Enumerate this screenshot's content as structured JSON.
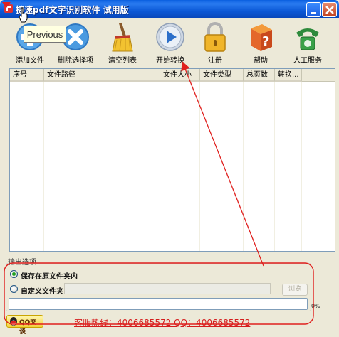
{
  "window": {
    "title": "捷速pdf文字识别软件  试用版",
    "accent": "#0b58d6"
  },
  "tooltip": {
    "text": "Previous"
  },
  "toolbar": {
    "add_file": "添加文件",
    "delete_selected": "删除选择项",
    "clear_list": "清空列表",
    "start_convert": "开始转换",
    "register": "注册",
    "help": "帮助",
    "support": "人工服务"
  },
  "icons": {
    "add_file": "plus-icon",
    "delete_selected": "x-icon",
    "clear_list": "broom-icon",
    "start_convert": "play-icon",
    "register": "padlock-icon",
    "help": "help-book-icon",
    "support": "telephone-icon"
  },
  "table": {
    "columns": [
      "序号",
      "文件路径",
      "文件大小",
      "文件类型",
      "总页数",
      "转换..."
    ],
    "rows": []
  },
  "output": {
    "section_label": "输出选项",
    "option_original": "保存在原文件夹内",
    "option_custom": "自定义文件夹",
    "selected": "original",
    "custom_path": "",
    "browse_label": "浏览"
  },
  "progress": {
    "value": 0,
    "label": "0%"
  },
  "footer": {
    "qq_label": "QQ交谈",
    "hotline": "客服热线：4006685572 QQ：4006685572"
  },
  "colors": {
    "annotation": "#e0201e",
    "progress": "#3cb44b",
    "hotline": "#d41c1c"
  }
}
